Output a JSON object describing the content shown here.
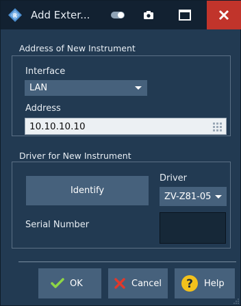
{
  "window": {
    "title": "Add Exter...",
    "colors": {
      "titlebar": "#122131",
      "background": "#223a52",
      "control": "#46617c",
      "close": "#c1342b",
      "ok_check": "#8ed645",
      "cancel_x": "#e0392b",
      "help_circle": "#f2c11c"
    }
  },
  "titlebar": {
    "icons": [
      "rs-logo-icon",
      "toggle-icon",
      "camera-icon",
      "maximize-icon",
      "close-icon"
    ]
  },
  "address_group": {
    "label": "Address of New Instrument",
    "interface_label": "Interface",
    "interface_value": "LAN",
    "address_label": "Address",
    "address_value": "10.10.10.10"
  },
  "driver_group": {
    "label": "Driver for New Instrument",
    "identify_label": "Identify",
    "driver_label": "Driver",
    "driver_value": "ZV-Z81-05",
    "serial_label": "Serial Number",
    "serial_value": ""
  },
  "buttons": {
    "ok": "OK",
    "cancel": "Cancel",
    "help": "Help"
  }
}
